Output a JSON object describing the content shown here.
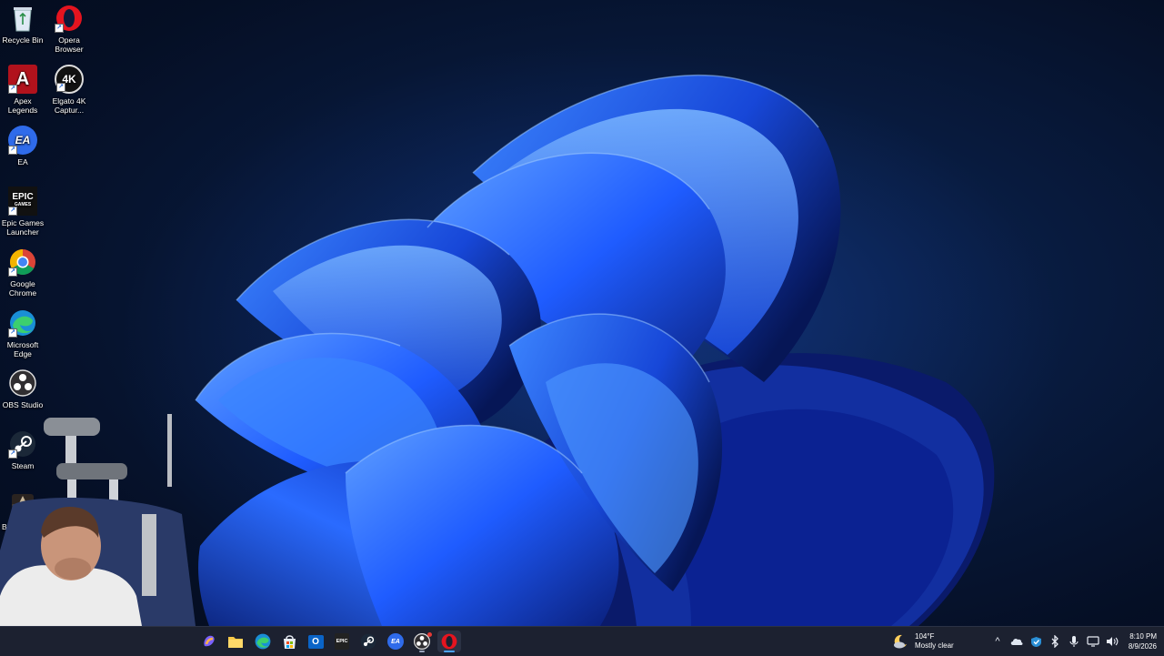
{
  "desktop_icons": [
    {
      "label": "Recycle Bin",
      "icon": "recycle-bin-icon"
    },
    {
      "label": "Opera Browser",
      "icon": "opera-icon"
    },
    {
      "label": "Apex Legends",
      "icon": "apex-legends-icon"
    },
    {
      "label": "Elgato 4K Captur...",
      "icon": "elgato-4k-icon"
    },
    {
      "label": "EA",
      "icon": "ea-icon"
    },
    {
      "label": "Epic Games Launcher",
      "icon": "epic-games-icon"
    },
    {
      "label": "Google Chrome",
      "icon": "chrome-icon"
    },
    {
      "label": "Microsoft Edge",
      "icon": "edge-icon"
    },
    {
      "label": "OBS Studio",
      "icon": "obs-icon"
    },
    {
      "label": "Steam",
      "icon": "steam-icon"
    },
    {
      "label": "Baldu",
      "icon": "baldurs-gate-icon"
    }
  ],
  "icon_glyphs": {
    "apex": "A",
    "elgato": "4K",
    "ea": "EA",
    "epic_top": "EPIC",
    "epic_bottom": "GAMES"
  },
  "taskbar": {
    "apps": [
      {
        "name": "copilot-icon"
      },
      {
        "name": "file-explorer-icon"
      },
      {
        "name": "edge-icon"
      },
      {
        "name": "microsoft-store-icon"
      },
      {
        "name": "outlook-icon"
      },
      {
        "name": "epic-games-icon"
      },
      {
        "name": "steam-icon"
      },
      {
        "name": "ea-icon"
      },
      {
        "name": "obs-icon"
      },
      {
        "name": "opera-icon",
        "active": true
      }
    ],
    "ea_glyph": "EA",
    "epic_glyph": "EPIC",
    "outlook_glyph": "O"
  },
  "weather": {
    "temperature": "104°F",
    "condition": "Mostly clear"
  },
  "tray": {
    "chevron": "^",
    "icons": [
      "onedrive-icon",
      "windows-security-icon",
      "bluetooth-icon",
      "microphone-icon",
      "network-icon",
      "volume-icon"
    ]
  },
  "clock": {
    "time": "8:10 PM",
    "date": "8/9/2026"
  },
  "colors": {
    "wallpaper_bg": "#06122b",
    "bloom_blue": "#1f5cff",
    "taskbar_bg": "#1c2130",
    "accent": "#4aa3ff"
  }
}
